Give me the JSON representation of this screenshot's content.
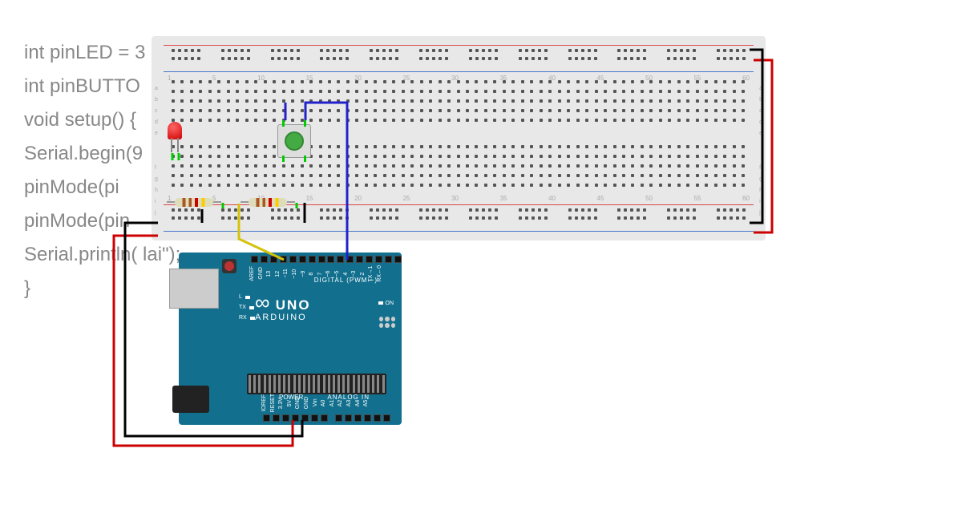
{
  "code": {
    "lines": [
      "int pinLED = 3",
      "int pinBUTTO",
      "void setup() {",
      "",
      "Serial.begin(9",
      "",
      "pinMode(pi",
      "pinMode(pin",
      "Serial.println(                                 lai\");",
      "",
      "}"
    ]
  },
  "arduino": {
    "brand": "ARDUINO",
    "model": "UNO",
    "digital_label": "DIGITAL (PWM ~)",
    "analog_label": "ANALOG IN",
    "power_label": "POWER",
    "on_label": "ON",
    "leds": [
      "L",
      "TX",
      "RX"
    ],
    "digital_pins": [
      "AREF",
      "GND",
      "13",
      "12",
      "~11",
      "~10",
      "~9",
      "8",
      "7",
      "~6",
      "~5",
      "4",
      "~3",
      "2",
      "TX→1",
      "RX←0"
    ],
    "power_pins": [
      "IOREF",
      "RESET",
      "3.3V",
      "5V",
      "GND",
      "GND",
      "Vin"
    ],
    "analog_pins": [
      "A0",
      "A1",
      "A2",
      "A3",
      "A4",
      "A5"
    ]
  },
  "breadboard": {
    "col_numbers": [
      "1",
      "5",
      "10",
      "15",
      "20",
      "25",
      "30",
      "35",
      "40",
      "45",
      "50",
      "55",
      "60"
    ],
    "row_labels_top": [
      "a",
      "b",
      "c",
      "d",
      "e"
    ],
    "row_labels_bot": [
      "f",
      "g",
      "h",
      "i",
      "j"
    ],
    "rail_pos": "+",
    "rail_neg": "−"
  },
  "components": {
    "led": {
      "name": "LED",
      "color": "red",
      "anode_col": 2,
      "cathode_col": 3
    },
    "button": {
      "name": "Pushbutton",
      "color": "green"
    },
    "resistor1": {
      "name": "Resistor",
      "placement": "LED pulldown"
    },
    "resistor2": {
      "name": "Resistor",
      "placement": "Button pulldown"
    }
  },
  "wires": [
    {
      "color": "#c00",
      "from": "Arduino 5V",
      "to": "Breadboard + rail"
    },
    {
      "color": "#000",
      "from": "Arduino GND",
      "to": "Breadboard − rail"
    },
    {
      "color": "#c00",
      "from": "+ rail right",
      "to": "+ rail jumper"
    },
    {
      "color": "#000",
      "from": "− rail right",
      "to": "− rail jumper"
    },
    {
      "color": "#cc0",
      "from": "Arduino D8",
      "to": "LED resistor"
    },
    {
      "color": "#22c",
      "from": "Arduino D2",
      "to": "Button"
    },
    {
      "color": "#000",
      "from": "LED cathode",
      "to": "− rail"
    },
    {
      "color": "#000",
      "from": "Button leg",
      "to": "− rail"
    },
    {
      "color": "#0c0",
      "from": "Button leg",
      "to": "tie point"
    },
    {
      "color": "#0c0",
      "from": "LED leg",
      "to": "tie point"
    }
  ]
}
